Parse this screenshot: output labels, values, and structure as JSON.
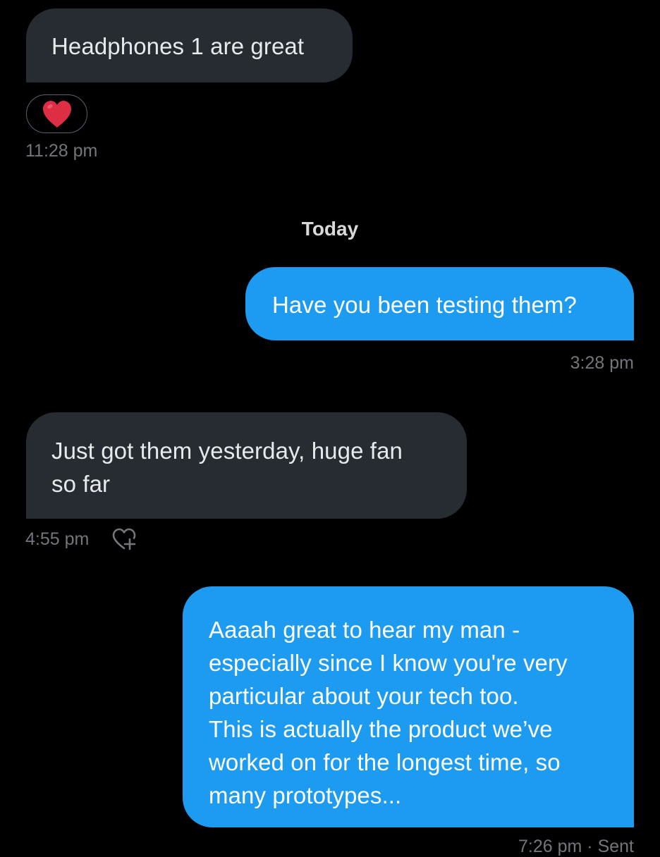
{
  "messages": [
    {
      "direction": "received",
      "lines": [
        "Headphones 1 are great"
      ],
      "reaction": "❤️",
      "time": "11:28 pm"
    },
    {
      "direction": "sent",
      "lines": [
        "Have you been testing them?"
      ],
      "time": "3:28 pm"
    },
    {
      "direction": "received",
      "lines": [
        "Just got them yesterday, huge fan",
        "so far"
      ],
      "time": "4:55 pm",
      "action_icon": "heart-plus-icon"
    },
    {
      "direction": "sent",
      "lines": [
        "Aaaah great to hear my man -",
        "especially since I know you're very",
        "particular about your tech too.",
        "This is actually the product we’ve",
        "worked on for the longest time, so",
        "many prototypes..."
      ],
      "time": "7:26 pm · Sent"
    }
  ],
  "divider": {
    "label": "Today"
  },
  "colors": {
    "background": "#000000",
    "received_bubble": "#262c32",
    "sent_bubble": "#1d9bf0",
    "timestamp": "#71767b",
    "divider_text": "#d9d9d9"
  }
}
